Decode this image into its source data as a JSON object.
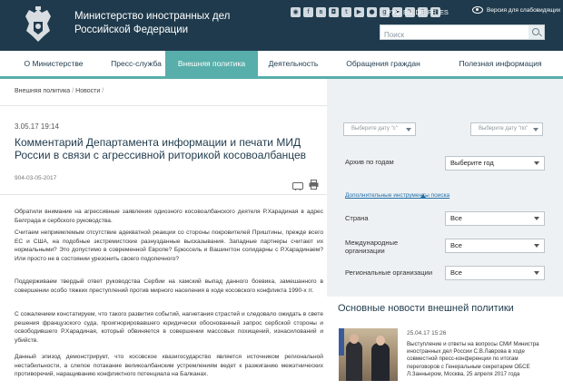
{
  "header": {
    "title_line1": "Министерство иностранных дел",
    "title_line2": "Российской Федерации",
    "social_icons": [
      "rss-icon",
      "facebook-icon",
      "vk-icon",
      "instagram-icon",
      "twitter-icon",
      "youtube-icon",
      "flickr-icon",
      "googleplus-icon",
      "telegram-icon",
      "livejournal-icon",
      "mobile-icon",
      "app-icon"
    ],
    "languages": [
      "РУС",
      "EN",
      "DE",
      "FR",
      "ES"
    ],
    "accessibility_label": "Версия для слабовидящих",
    "search_placeholder": "Поиск"
  },
  "nav": {
    "items": [
      "О Министерстве",
      "Пресс-служба",
      "Внешняя политика",
      "Деятельность",
      "Обращения граждан",
      "Полезная информация"
    ],
    "active": "Внешняя политика"
  },
  "breadcrumb": [
    "Внешняя политика",
    "Новости"
  ],
  "article": {
    "date": "3.05.17 19:14",
    "title": "Комментарий Департамента информации и печати МИД России в связи с агрессивной риторикой косовоалбанцев",
    "number": "904-03-05-2017",
    "paragraphs": [
      "Обратили внимание на агрессивные заявления одиозного косовоалбанского деятеля Р.Харадиная в адрес Белграда и сербского руководства.",
      "Считаем неприемлемым отсутствие адекватной реакции со стороны покровителей Приштины, прежде всего ЕС и США, на подобные экстремистские разнузданные высказывания. Западные партнеры считают их нормальными? Это допустимо в современной Европе? Брюссель и Вашингтон солидарны с Р.Харадинаем? Или просто не в состоянии урезонить своего подопечного?",
      "Поддерживаем твердый ответ руководства Сербии на хамский выпад данного боевика, замешанного в совершении особо тяжких преступлений против мирного населения в ходе косовского конфликта 1990-х гг.",
      "С сожалением констатируем, что такого развития событий, нагнетания страстей и следовало ожидать в свете решения французского суда, проигнорировавшего юридически обоснованный запрос сербской стороны и освободившего Р.Харадиная, который обвиняется в совершении массовых похищений, изнасилований и убийств.",
      "Данный эпизод демонстрирует, что косовское квазигосударство является источником региональной нестабильности, а слепое потакание великоалбанским устремлениям ведет к разжиганию межэтнических противоречий, наращиванию конфликтного потенциала на Балканах."
    ]
  },
  "filters": {
    "date_from_placeholder": "Выберите дату \"с\"",
    "date_to_placeholder": "Выберите дату \"по\"",
    "archive_label": "Архив по годам",
    "archive_value": "Выберите год",
    "advanced_search": "Дополнительные инструменты поиска",
    "country_label": "Страна",
    "country_value": "Все",
    "intl_orgs_label": "Международные организации",
    "intl_orgs_value": "Все",
    "regional_orgs_label": "Региональные организации",
    "regional_orgs_value": "Все"
  },
  "news": {
    "heading": "Основные новости внешней политики",
    "date": "25.04.17 15:26",
    "text": "Выступление и ответы на вопросы СМИ Министра иностранных дел России С.В.Лаврова в ходе совместной пресс-конференции по итогам переговоров с Генеральным секретарем ОБСЕ Л.Занньером, Москва, 25 апреля 2017 года"
  }
}
